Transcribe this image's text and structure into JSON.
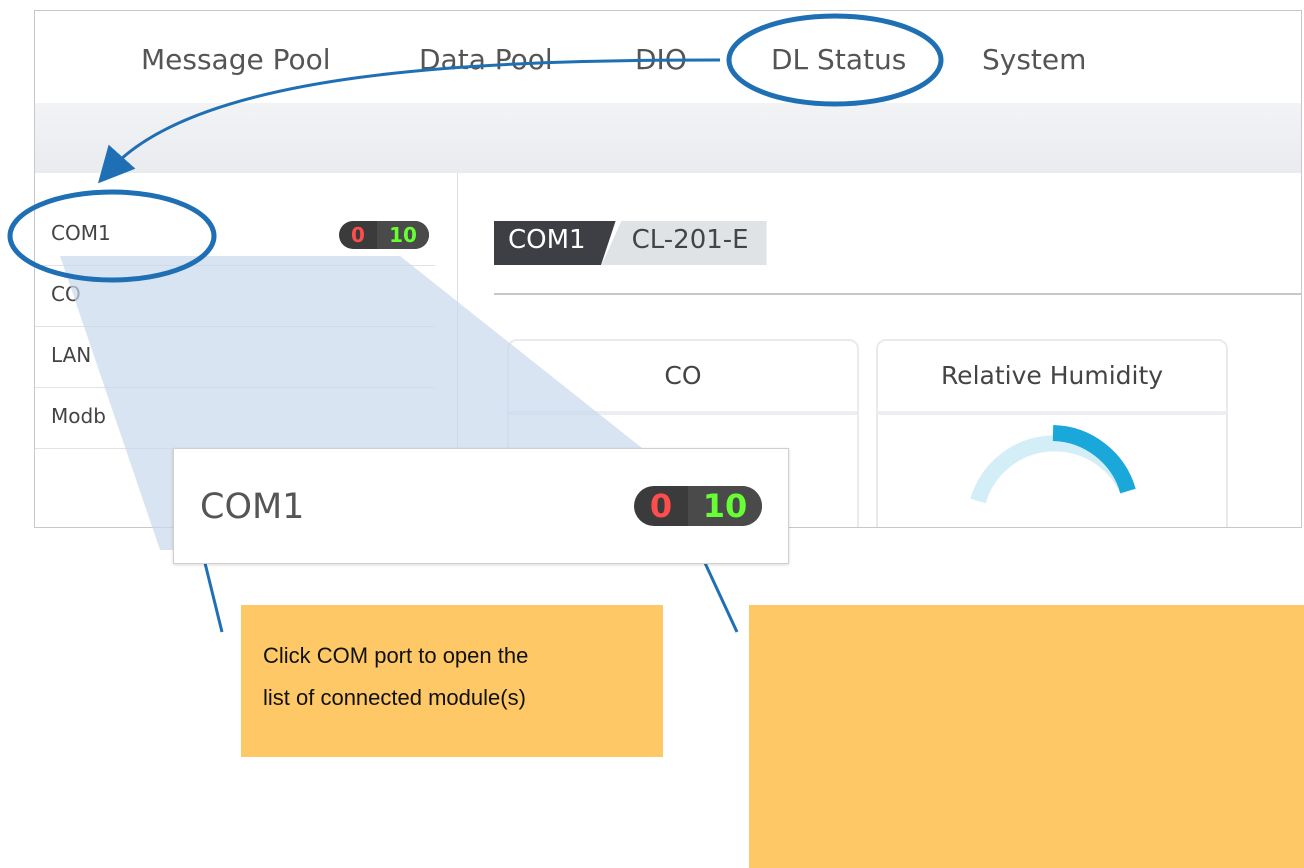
{
  "nav": {
    "items": [
      "Message Pool",
      "Data Pool",
      "DIO",
      "DL Status",
      "System"
    ]
  },
  "sidebar": {
    "items": [
      {
        "label": "COM1",
        "badge_red": "0",
        "badge_green": "10"
      },
      {
        "label": "CO"
      },
      {
        "label": "LAN"
      },
      {
        "label": "Modb"
      }
    ]
  },
  "main": {
    "com_tag": "COM1",
    "model_tag": "CL-201-E",
    "cards": [
      "CO",
      "Relative Humidity"
    ]
  },
  "zoom": {
    "label": "COM1",
    "badge_red": "0",
    "badge_green": "10"
  },
  "notes": {
    "left_line1": "Click COM port to open the",
    "left_line2": "list of connected module(s)"
  },
  "colors": {
    "annotation_blue": "#1f6fb5",
    "note_fill": "#fdc865",
    "gauge": "#1aa7d9"
  }
}
